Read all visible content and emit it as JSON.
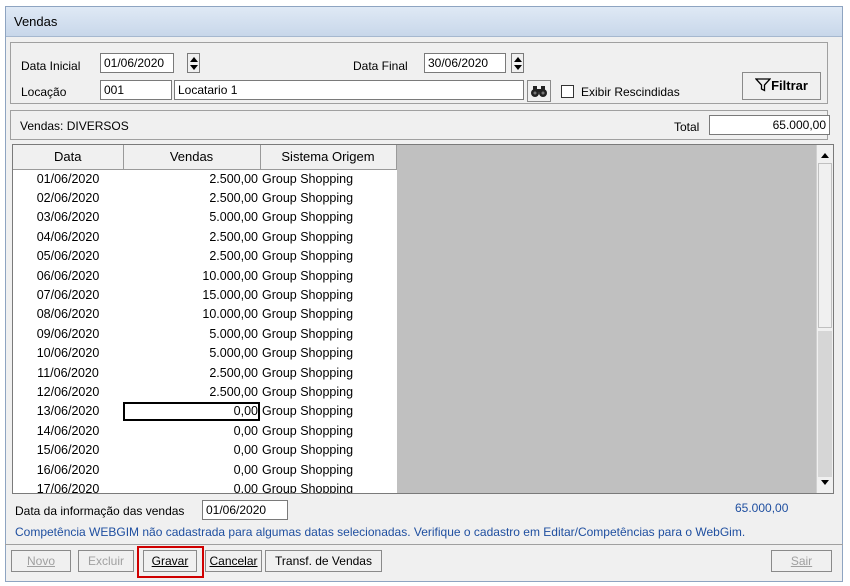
{
  "window": {
    "title": "Vendas"
  },
  "filters": {
    "data_inicial_label": "Data Inicial",
    "data_inicial_value": "01/06/2020",
    "data_final_label": "Data Final",
    "data_final_value": "30/06/2020",
    "locacao_label": "Locação",
    "locacao_code": "001",
    "locacao_name": "Locatario 1",
    "exibir_label": "Exibir Rescindidas",
    "filtrar_label": "Filtrar"
  },
  "summary": {
    "vendas_label": "Vendas: DIVERSOS",
    "total_label": "Total",
    "total_value": "65.000,00"
  },
  "grid": {
    "headers": [
      "Data",
      "Vendas",
      "Sistema Origem"
    ],
    "rows": [
      [
        "01/06/2020",
        "2.500,00",
        "Group Shopping"
      ],
      [
        "02/06/2020",
        "2.500,00",
        "Group Shopping"
      ],
      [
        "03/06/2020",
        "5.000,00",
        "Group Shopping"
      ],
      [
        "04/06/2020",
        "2.500,00",
        "Group Shopping"
      ],
      [
        "05/06/2020",
        "2.500,00",
        "Group Shopping"
      ],
      [
        "06/06/2020",
        "10.000,00",
        "Group Shopping"
      ],
      [
        "07/06/2020",
        "15.000,00",
        "Group Shopping"
      ],
      [
        "08/06/2020",
        "10.000,00",
        "Group Shopping"
      ],
      [
        "09/06/2020",
        "5.000,00",
        "Group Shopping"
      ],
      [
        "10/06/2020",
        "5.000,00",
        "Group Shopping"
      ],
      [
        "11/06/2020",
        "2.500,00",
        "Group Shopping"
      ],
      [
        "12/06/2020",
        "2.500,00",
        "Group Shopping"
      ],
      [
        "13/06/2020",
        "0,00",
        "Group Shopping"
      ],
      [
        "14/06/2020",
        "0,00",
        "Group Shopping"
      ],
      [
        "15/06/2020",
        "0,00",
        "Group Shopping"
      ],
      [
        "16/06/2020",
        "0,00",
        "Group Shopping"
      ],
      [
        "17/06/2020",
        "0,00",
        "Group Shopping"
      ]
    ],
    "focused_row": 12
  },
  "footer": {
    "data_info_label": "Data da informação das vendas",
    "data_info_value": "01/06/2020",
    "sum_value": "65.000,00",
    "warning": "Competência WEBGIM não cadastrada para algumas datas selecionadas. Verifique o cadastro em Editar/Competências para o WebGim."
  },
  "buttons": {
    "novo": "Novo",
    "excluir": "Excluir",
    "gravar": "Gravar",
    "cancelar": "Cancelar",
    "transf": "Transf. de Vendas",
    "sair": "Sair"
  },
  "colors": {
    "warning_text": "#1f4fa0",
    "highlight_border": "#d00000",
    "grid_empty": "#c0c0c0"
  }
}
